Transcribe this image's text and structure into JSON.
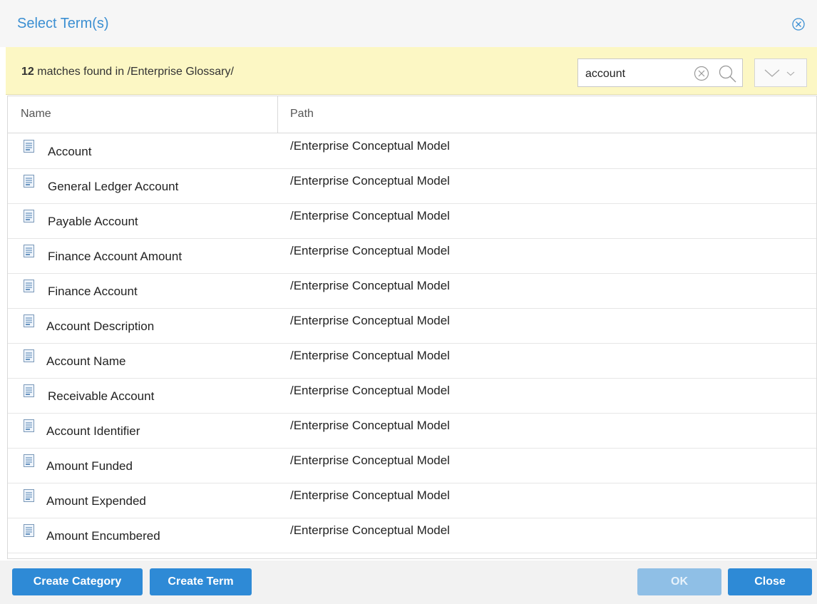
{
  "dialog": {
    "title": "Select Term(s)"
  },
  "search_bar": {
    "match_count": "12",
    "match_text": " matches found in /Enterprise Glossary/",
    "query": "account"
  },
  "table": {
    "columns": [
      "Name",
      "Path"
    ],
    "rows": [
      {
        "name": "Account",
        "path": "/Enterprise Conceptual Model"
      },
      {
        "name": "General Ledger Account",
        "path": "/Enterprise Conceptual Model"
      },
      {
        "name": "Payable Account",
        "path": "/Enterprise Conceptual Model"
      },
      {
        "name": "Finance Account Amount",
        "path": "/Enterprise Conceptual Model"
      },
      {
        "name": "Finance Account",
        "path": "/Enterprise Conceptual Model"
      },
      {
        "name": "Account Description",
        "path": "/Enterprise Conceptual Model"
      },
      {
        "name": "Account Name",
        "path": "/Enterprise Conceptual Model"
      },
      {
        "name": "Receivable Account",
        "path": "/Enterprise Conceptual Model"
      },
      {
        "name": "Account Identifier",
        "path": "/Enterprise Conceptual Model"
      },
      {
        "name": "Amount Funded",
        "path": "/Enterprise Conceptual Model"
      },
      {
        "name": "Amount Expended",
        "path": "/Enterprise Conceptual Model"
      },
      {
        "name": "Amount Encumbered",
        "path": "/Enterprise Conceptual Model"
      }
    ],
    "row_icon": "term-document-icon"
  },
  "footer": {
    "create_category": "Create Category",
    "create_term": "Create Term",
    "ok": "OK",
    "close": "Close"
  },
  "colors": {
    "accent": "#2e8ad6",
    "title": "#3b8fd2",
    "search_bar_bg": "#fcf7c4"
  }
}
